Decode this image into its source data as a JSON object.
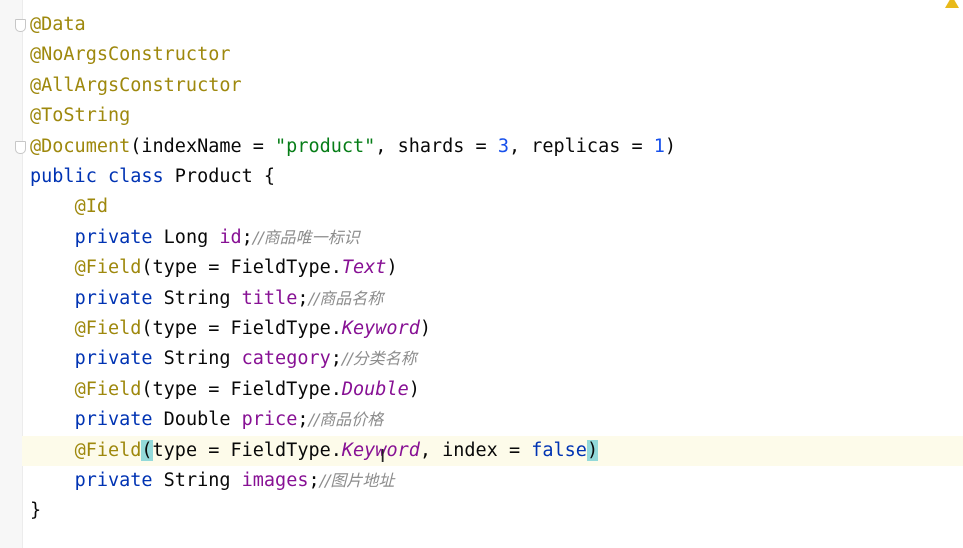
{
  "editor": {
    "lines": [
      [
        {
          "t": "@Data",
          "c": "ann"
        }
      ],
      [
        {
          "t": "@NoArgsConstructor",
          "c": "ann"
        }
      ],
      [
        {
          "t": "@AllArgsConstructor",
          "c": "ann"
        }
      ],
      [
        {
          "t": "@ToString",
          "c": "ann"
        }
      ],
      [
        {
          "t": "@Document",
          "c": "ann"
        },
        {
          "t": "(indexName = ",
          "c": ""
        },
        {
          "t": "\"product\"",
          "c": "str"
        },
        {
          "t": ", shards = ",
          "c": ""
        },
        {
          "t": "3",
          "c": "num"
        },
        {
          "t": ", replicas = ",
          "c": ""
        },
        {
          "t": "1",
          "c": "num"
        },
        {
          "t": ")",
          "c": ""
        }
      ],
      [
        {
          "t": "public class ",
          "c": "kw"
        },
        {
          "t": "Product {",
          "c": ""
        }
      ],
      [
        {
          "t": "    ",
          "c": ""
        },
        {
          "t": "@Id",
          "c": "ann"
        }
      ],
      [
        {
          "t": "    ",
          "c": ""
        },
        {
          "t": "private ",
          "c": "kw"
        },
        {
          "t": "Long ",
          "c": ""
        },
        {
          "t": "id",
          "c": "fld"
        },
        {
          "t": ";",
          "c": ""
        },
        {
          "t": "//商品唯一标识",
          "c": "cm"
        }
      ],
      [
        {
          "t": "    ",
          "c": ""
        },
        {
          "t": "@Field",
          "c": "ann"
        },
        {
          "t": "(type = FieldType.",
          "c": ""
        },
        {
          "t": "Text",
          "c": "en"
        },
        {
          "t": ")",
          "c": ""
        }
      ],
      [
        {
          "t": "    ",
          "c": ""
        },
        {
          "t": "private ",
          "c": "kw"
        },
        {
          "t": "String ",
          "c": ""
        },
        {
          "t": "title",
          "c": "fld"
        },
        {
          "t": ";",
          "c": ""
        },
        {
          "t": "//商品名称",
          "c": "cm"
        }
      ],
      [
        {
          "t": "    ",
          "c": ""
        },
        {
          "t": "@Field",
          "c": "ann"
        },
        {
          "t": "(type = FieldType.",
          "c": ""
        },
        {
          "t": "Keyword",
          "c": "en"
        },
        {
          "t": ")",
          "c": ""
        }
      ],
      [
        {
          "t": "    ",
          "c": ""
        },
        {
          "t": "private ",
          "c": "kw"
        },
        {
          "t": "String ",
          "c": ""
        },
        {
          "t": "category",
          "c": "fld"
        },
        {
          "t": ";",
          "c": ""
        },
        {
          "t": "//分类名称",
          "c": "cm"
        }
      ],
      [
        {
          "t": "    ",
          "c": ""
        },
        {
          "t": "@Field",
          "c": "ann"
        },
        {
          "t": "(type = FieldType.",
          "c": ""
        },
        {
          "t": "Double",
          "c": "en"
        },
        {
          "t": ")",
          "c": ""
        }
      ],
      [
        {
          "t": "    ",
          "c": ""
        },
        {
          "t": "private ",
          "c": "kw"
        },
        {
          "t": "Double ",
          "c": ""
        },
        {
          "t": "price",
          "c": "fld"
        },
        {
          "t": ";",
          "c": ""
        },
        {
          "t": "//商品价格",
          "c": "cm"
        }
      ],
      [
        {
          "t": "    ",
          "c": ""
        },
        {
          "t": "@Field",
          "c": "ann"
        },
        {
          "t": "(",
          "c": "br"
        },
        {
          "t": "type = FieldType.",
          "c": ""
        },
        {
          "t": "Keyword",
          "c": "en"
        },
        {
          "t": ", index = ",
          "c": ""
        },
        {
          "t": "false",
          "c": "kw"
        },
        {
          "t": ")",
          "c": "br"
        }
      ],
      [
        {
          "t": "    ",
          "c": ""
        },
        {
          "t": "private ",
          "c": "kw"
        },
        {
          "t": "String ",
          "c": ""
        },
        {
          "t": "images",
          "c": "fld"
        },
        {
          "t": ";",
          "c": ""
        },
        {
          "t": "//图片地址",
          "c": "cm"
        }
      ],
      [
        {
          "t": "}",
          "c": ""
        }
      ]
    ],
    "caret_line": 14
  }
}
